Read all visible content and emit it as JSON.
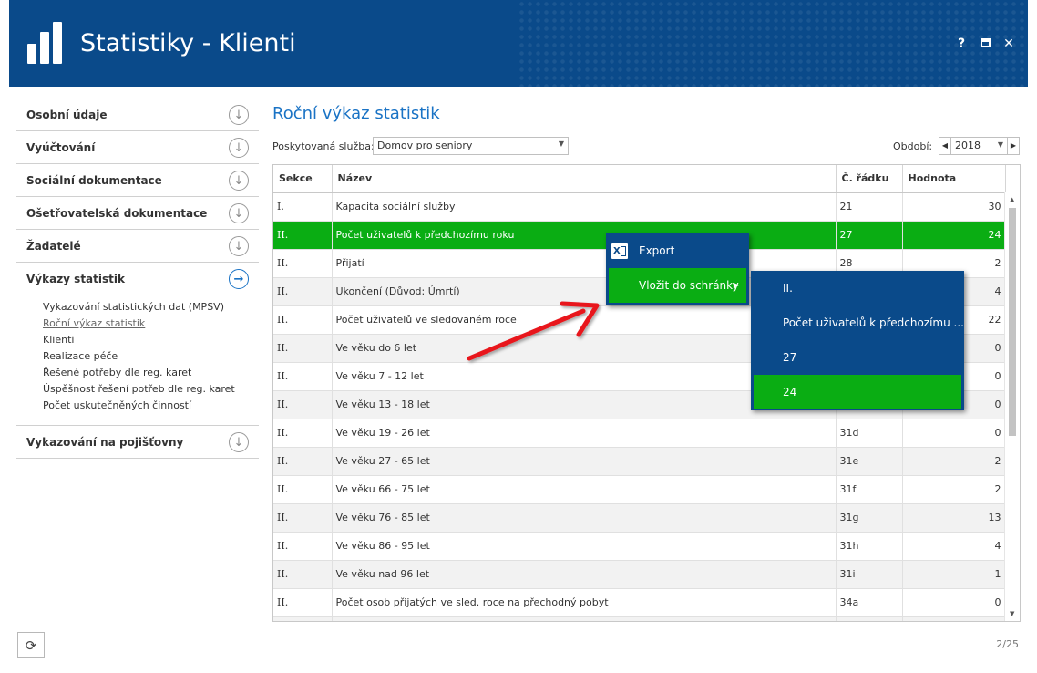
{
  "app": {
    "title": "Statistiky - Klienti",
    "window_buttons": {
      "help": "?",
      "close": "✕"
    }
  },
  "sidebar": {
    "items": [
      {
        "label": "Osobní údaje"
      },
      {
        "label": "Vyúčtování"
      },
      {
        "label": "Sociální dokumentace"
      },
      {
        "label": "Ošetřovatelská dokumentace"
      },
      {
        "label": "Žadatelé"
      }
    ],
    "active_group": {
      "label": "Výkazy statistik",
      "subitems": [
        "Vykazování statistických dat (MPSV)",
        "Roční výkaz statistik",
        "Klienti",
        "Realizace péče",
        "Řešené potřeby dle reg. karet",
        "Úspěšnost řešení potřeb dle reg. karet",
        "Počet uskutečněných činností"
      ]
    },
    "last_item": {
      "label": "Vykazování na pojišťovny"
    }
  },
  "main": {
    "title": "Roční výkaz statistik",
    "service_label": "Poskytovaná služba:",
    "service_value": "Domov pro seniory",
    "period_label": "Období:",
    "period_value": "2018"
  },
  "grid": {
    "columns": [
      "Sekce",
      "Název",
      "Č. řádku",
      "Hodnota"
    ],
    "selected_row": 1,
    "rows": [
      [
        "I.",
        "Kapacita sociální služby",
        "21",
        "30"
      ],
      [
        "II.",
        "Počet uživatelů k předchozímu roku",
        "27",
        "24"
      ],
      [
        "II.",
        "Přijatí",
        "28",
        "2"
      ],
      [
        "II.",
        "Ukončení (Důvod: Úmrtí)",
        "",
        "4"
      ],
      [
        "II.",
        "Počet uživatelů ve sledovaném roce",
        "",
        "22"
      ],
      [
        "II.",
        "Ve věku do 6 let",
        "",
        "0"
      ],
      [
        "II.",
        "Ve věku 7 - 12 let",
        "",
        "0"
      ],
      [
        "II.",
        "Ve věku 13 - 18 let",
        "",
        "0"
      ],
      [
        "II.",
        "Ve věku 19 - 26 let",
        "31d",
        "0"
      ],
      [
        "II.",
        "Ve věku 27 - 65 let",
        "31e",
        "2"
      ],
      [
        "II.",
        "Ve věku 66 - 75 let",
        "31f",
        "2"
      ],
      [
        "II.",
        "Ve věku 76 - 85 let",
        "31g",
        "13"
      ],
      [
        "II.",
        "Ve věku 86 - 95 let",
        "31h",
        "4"
      ],
      [
        "II.",
        "Ve věku nad 96 let",
        "31i",
        "1"
      ],
      [
        "II.",
        "Počet osob přijatých ve sled. roce na přechodný pobyt",
        "34a",
        "0"
      ],
      [
        "",
        "",
        "",
        ""
      ]
    ]
  },
  "context_menu": {
    "export_label": "Export",
    "clipboard_label": "Vložit do schránky",
    "submenu": [
      "II.",
      "Počet uživatelů k předchozímu ...",
      "27",
      "24"
    ]
  },
  "footer": {
    "pager": "2/25"
  },
  "colors": {
    "brand": "#0a4a8a",
    "accent": "#1a73c5",
    "selection": "#0aad13"
  }
}
